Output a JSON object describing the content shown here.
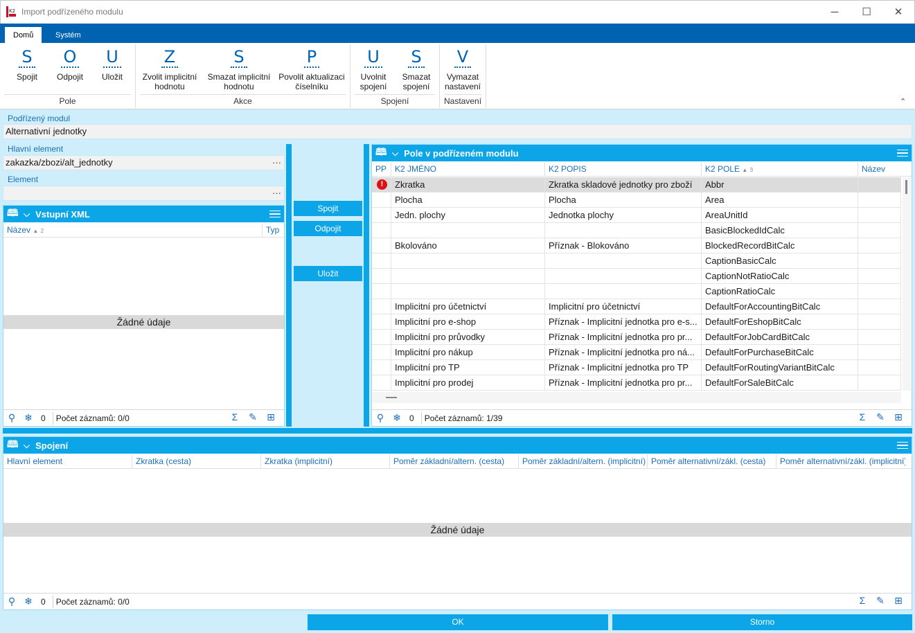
{
  "window": {
    "title": "Import podřízeného modulu",
    "minimize_glyph": "─",
    "maximize_glyph": "☐",
    "close_glyph": "✕"
  },
  "tabs": [
    {
      "label": "Domů",
      "active": true
    },
    {
      "label": "Systém",
      "active": false
    }
  ],
  "ribbon": {
    "groups": [
      {
        "label": "Pole",
        "buttons": [
          {
            "letter": "S",
            "label": "Spojit"
          },
          {
            "letter": "O",
            "label": "Odpojit"
          },
          {
            "letter": "U",
            "label": "Uložit"
          }
        ]
      },
      {
        "label": "Akce",
        "buttons": [
          {
            "letter": "Z",
            "label": "Zvolit implicitní hodnotu"
          },
          {
            "letter": "S",
            "label": "Smazat implicitní hodnotu"
          },
          {
            "letter": "P",
            "label": "Povolit aktualizaci číselníku"
          }
        ]
      },
      {
        "label": "Spojení",
        "buttons": [
          {
            "letter": "U",
            "label": "Uvolnit spojení"
          },
          {
            "letter": "S",
            "label": "Smazat spojení"
          }
        ]
      },
      {
        "label": "Nastavení",
        "buttons": [
          {
            "letter": "V",
            "label": "Vymazat nastavení"
          }
        ]
      }
    ],
    "collapse_glyph": "⌃"
  },
  "form": {
    "child_module_label": "Podřízený modul",
    "child_module_value": "Alternativní jednotky",
    "main_element_label": "Hlavní element",
    "main_element_value": "zakazka/zbozi/alt_jednotky",
    "element_label": "Element",
    "element_value": "",
    "ellipsis": "···"
  },
  "input_xml": {
    "title": "Vstupní XML",
    "columns": {
      "name": "Název",
      "name_sort": "2",
      "type": "Typ"
    },
    "empty_text": "Žádné údaje",
    "footer_count": "0",
    "footer_records": "Počet záznamů: 0/0"
  },
  "middle_buttons": {
    "connect": "Spojit",
    "disconnect": "Odpojit",
    "save": "Uložit"
  },
  "fields_panel": {
    "title": "Pole v podřízeném modulu",
    "columns": {
      "pp": "PP",
      "name": "K2 JMÉNO",
      "desc": "K2 POPIS",
      "field": "K2 POLE",
      "field_sort": "3",
      "nazev": "Název"
    },
    "rows": [
      {
        "warn": true,
        "name": "Zkratka",
        "desc": "Zkratka skladové jednotky pro zboží",
        "field": "Abbr",
        "nazev": ""
      },
      {
        "warn": false,
        "name": "Plocha",
        "desc": "Plocha",
        "field": "Area",
        "nazev": ""
      },
      {
        "warn": false,
        "name": "Jedn. plochy",
        "desc": "Jednotka plochy",
        "field": "AreaUnitId",
        "nazev": ""
      },
      {
        "warn": false,
        "name": "",
        "desc": "",
        "field": "BasicBlockedIdCalc",
        "nazev": ""
      },
      {
        "warn": false,
        "name": "Bkolováno",
        "desc": "Příznak - Blokováno",
        "field": "BlockedRecordBitCalc",
        "nazev": ""
      },
      {
        "warn": false,
        "name": "",
        "desc": "",
        "field": "CaptionBasicCalc",
        "nazev": ""
      },
      {
        "warn": false,
        "name": "",
        "desc": "",
        "field": "CaptionNotRatioCalc",
        "nazev": ""
      },
      {
        "warn": false,
        "name": "",
        "desc": "",
        "field": "CaptionRatioCalc",
        "nazev": ""
      },
      {
        "warn": false,
        "name": "Implicitní pro účetnictví",
        "desc": "Implicitní pro účetnictví",
        "field": "DefaultForAccountingBitCalc",
        "nazev": ""
      },
      {
        "warn": false,
        "name": "Implicitní pro e-shop",
        "desc": "Příznak - Implicitní jednotka pro e-s...",
        "field": "DefaultForEshopBitCalc",
        "nazev": ""
      },
      {
        "warn": false,
        "name": "Implicitní pro průvodky",
        "desc": "Příznak - Implicitní jednotka pro pr...",
        "field": "DefaultForJobCardBitCalc",
        "nazev": ""
      },
      {
        "warn": false,
        "name": "Implicitní pro nákup",
        "desc": "Příznak - Implicitní jednotka pro ná...",
        "field": "DefaultForPurchaseBitCalc",
        "nazev": ""
      },
      {
        "warn": false,
        "name": "Implicitní pro TP",
        "desc": "Příznak - Implicitní jednotka pro TP",
        "field": "DefaultForRoutingVariantBitCalc",
        "nazev": ""
      },
      {
        "warn": false,
        "name": "Implicitní pro prodej",
        "desc": "Příznak - Implicitní jednotka pro pr...",
        "field": "DefaultForSaleBitCalc",
        "nazev": ""
      }
    ],
    "footer_count": "0",
    "footer_records": "Počet záznamů: 1/39"
  },
  "connections": {
    "title": "Spojení",
    "columns": [
      "Hlavní element",
      "Zkratka (cesta)",
      "Zkratka (implicitní)",
      "Poměr základní/altern. (cesta)",
      "Poměr základní/altern. (implicitní)",
      "Poměr alternativní/zákl. (cesta)",
      "Poměr alternativní/zákl. (implicitní)"
    ],
    "empty_text": "Žádné údaje",
    "footer_count": "0",
    "footer_records": "Počet záznamů: 0/0"
  },
  "dialog_buttons": {
    "ok": "OK",
    "cancel": "Storno"
  },
  "colors": {
    "accent": "#0ba5e8",
    "ribbon_tab": "#0063b1",
    "background": "#cfeefc",
    "warning": "#dd1111"
  }
}
